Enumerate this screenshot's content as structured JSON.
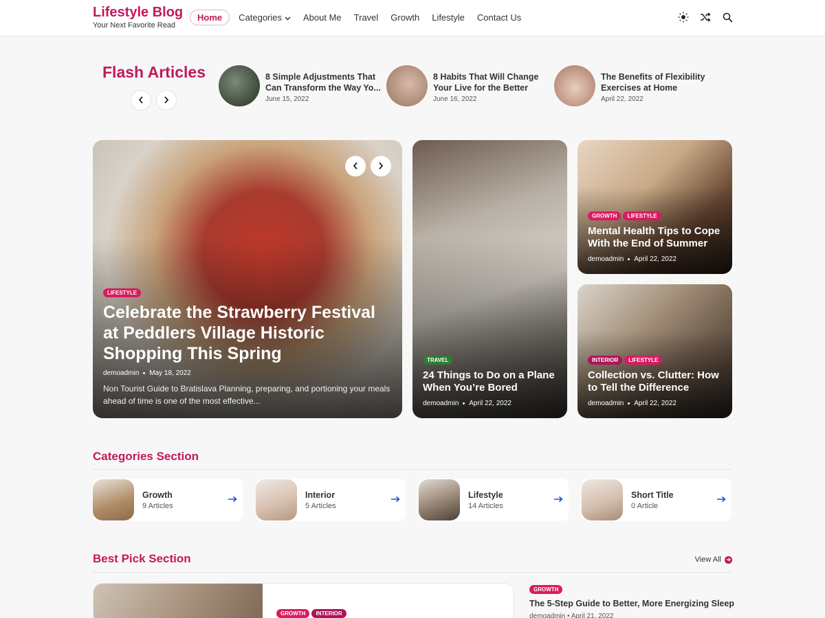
{
  "logo": {
    "title": "Lifestyle Blog",
    "subtitle": "Your Next Favorite Read"
  },
  "nav": {
    "home": "Home",
    "categories": "Categories",
    "about": "About Me",
    "travel": "Travel",
    "growth": "Growth",
    "lifestyle": "Lifestyle",
    "contact": "Contact Us"
  },
  "header_icons": [
    "sun-icon",
    "shuffle-icon",
    "search-icon"
  ],
  "flash": {
    "title": "Flash Articles",
    "items": [
      {
        "title": "8 Simple Adjustments That Can Transform the Way Yo...",
        "date": "June 15, 2022"
      },
      {
        "title": "8 Habits That Will Change Your Live for the Better",
        "date": "June 16, 2022"
      },
      {
        "title": "The Benefits of Flexibility Exercises at Home",
        "date": "April 22, 2022"
      }
    ]
  },
  "hero": {
    "main": {
      "tags": [
        "LIFESTYLE"
      ],
      "title": "Celebrate the Strawberry Festival at Peddlers Village Historic Shopping This Spring",
      "author": "demoadmin",
      "date": "May 18, 2022",
      "excerpt": "Non Tourist Guide to Bratislava Planning, preparing, and portioning your meals ahead of time is one of the most effective..."
    },
    "plane": {
      "tags": [
        "TRAVEL"
      ],
      "title": "24 Things to Do on a Plane When You’re Bored",
      "author": "demoadmin",
      "date": "April 22, 2022"
    },
    "mental": {
      "tags": [
        "GROWTH",
        "LIFESTYLE"
      ],
      "title": "Mental Health Tips to Cope With the End of Summer",
      "author": "demoadmin",
      "date": "April 22, 2022"
    },
    "clutter": {
      "tags": [
        "INTERIOR",
        "LIFESTYLE"
      ],
      "title": "Collection vs. Clutter: How to Tell the Difference",
      "author": "demoadmin",
      "date": "April 22, 2022"
    }
  },
  "categories": {
    "title": "Categories Section",
    "items": [
      {
        "name": "Growth",
        "count": "9 Articles"
      },
      {
        "name": "Interior",
        "count": "5 Articles"
      },
      {
        "name": "Lifestyle",
        "count": "14 Articles"
      },
      {
        "name": "Short Title",
        "count": "0 Article"
      }
    ]
  },
  "best_pick": {
    "title": "Best Pick Section",
    "view_all": "View All",
    "card_tags": [
      "GROWTH",
      "INTERIOR"
    ],
    "side": {
      "tag": "GROWTH",
      "title": "The 5-Step Guide to Better, More Energizing Sleep",
      "author": "demoadmin",
      "date": "April 21, 2022"
    }
  },
  "colors": {
    "accent": "#c2185b",
    "arrow_blue": "#1e4fd6",
    "travel_green": "#2e7d32"
  }
}
